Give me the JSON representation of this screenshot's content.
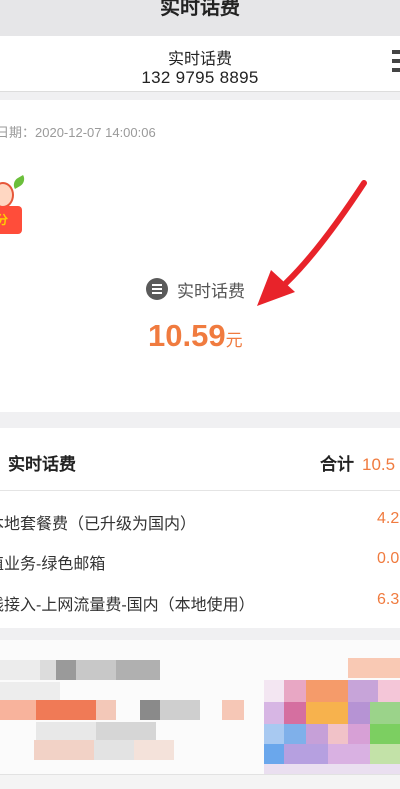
{
  "window": {
    "title": "实时话费"
  },
  "account": {
    "name": "实时话费",
    "phone": "132 9795 8895"
  },
  "summary": {
    "date_label": "日期：2020-12-07 14:00:06",
    "badge_text": "分",
    "bill_label": "实时话费",
    "amount_value": "10.59",
    "amount_unit": "元",
    "arrow_color": "#e8232a"
  },
  "detail": {
    "title": "实时话费",
    "total_label": "合计",
    "total_value": "10.5",
    "items": [
      {
        "label": "本地套餐费（已升级为国内）",
        "amount": "4.2"
      },
      {
        "label": "值业务-绿色邮箱",
        "amount": "0.0"
      },
      {
        "label": "线接入-上网流量费-国内（本地使用）",
        "amount": "6.3"
      }
    ]
  },
  "colors": {
    "accent": "#f07b3f",
    "header_bg": "#e6e6e8",
    "page_bg": "#f0f0f2"
  },
  "icons": {
    "menu": "more-menu-icon",
    "list": "list-icon",
    "gift": "gift-icon",
    "arrow": "red-arrow-annotation"
  }
}
